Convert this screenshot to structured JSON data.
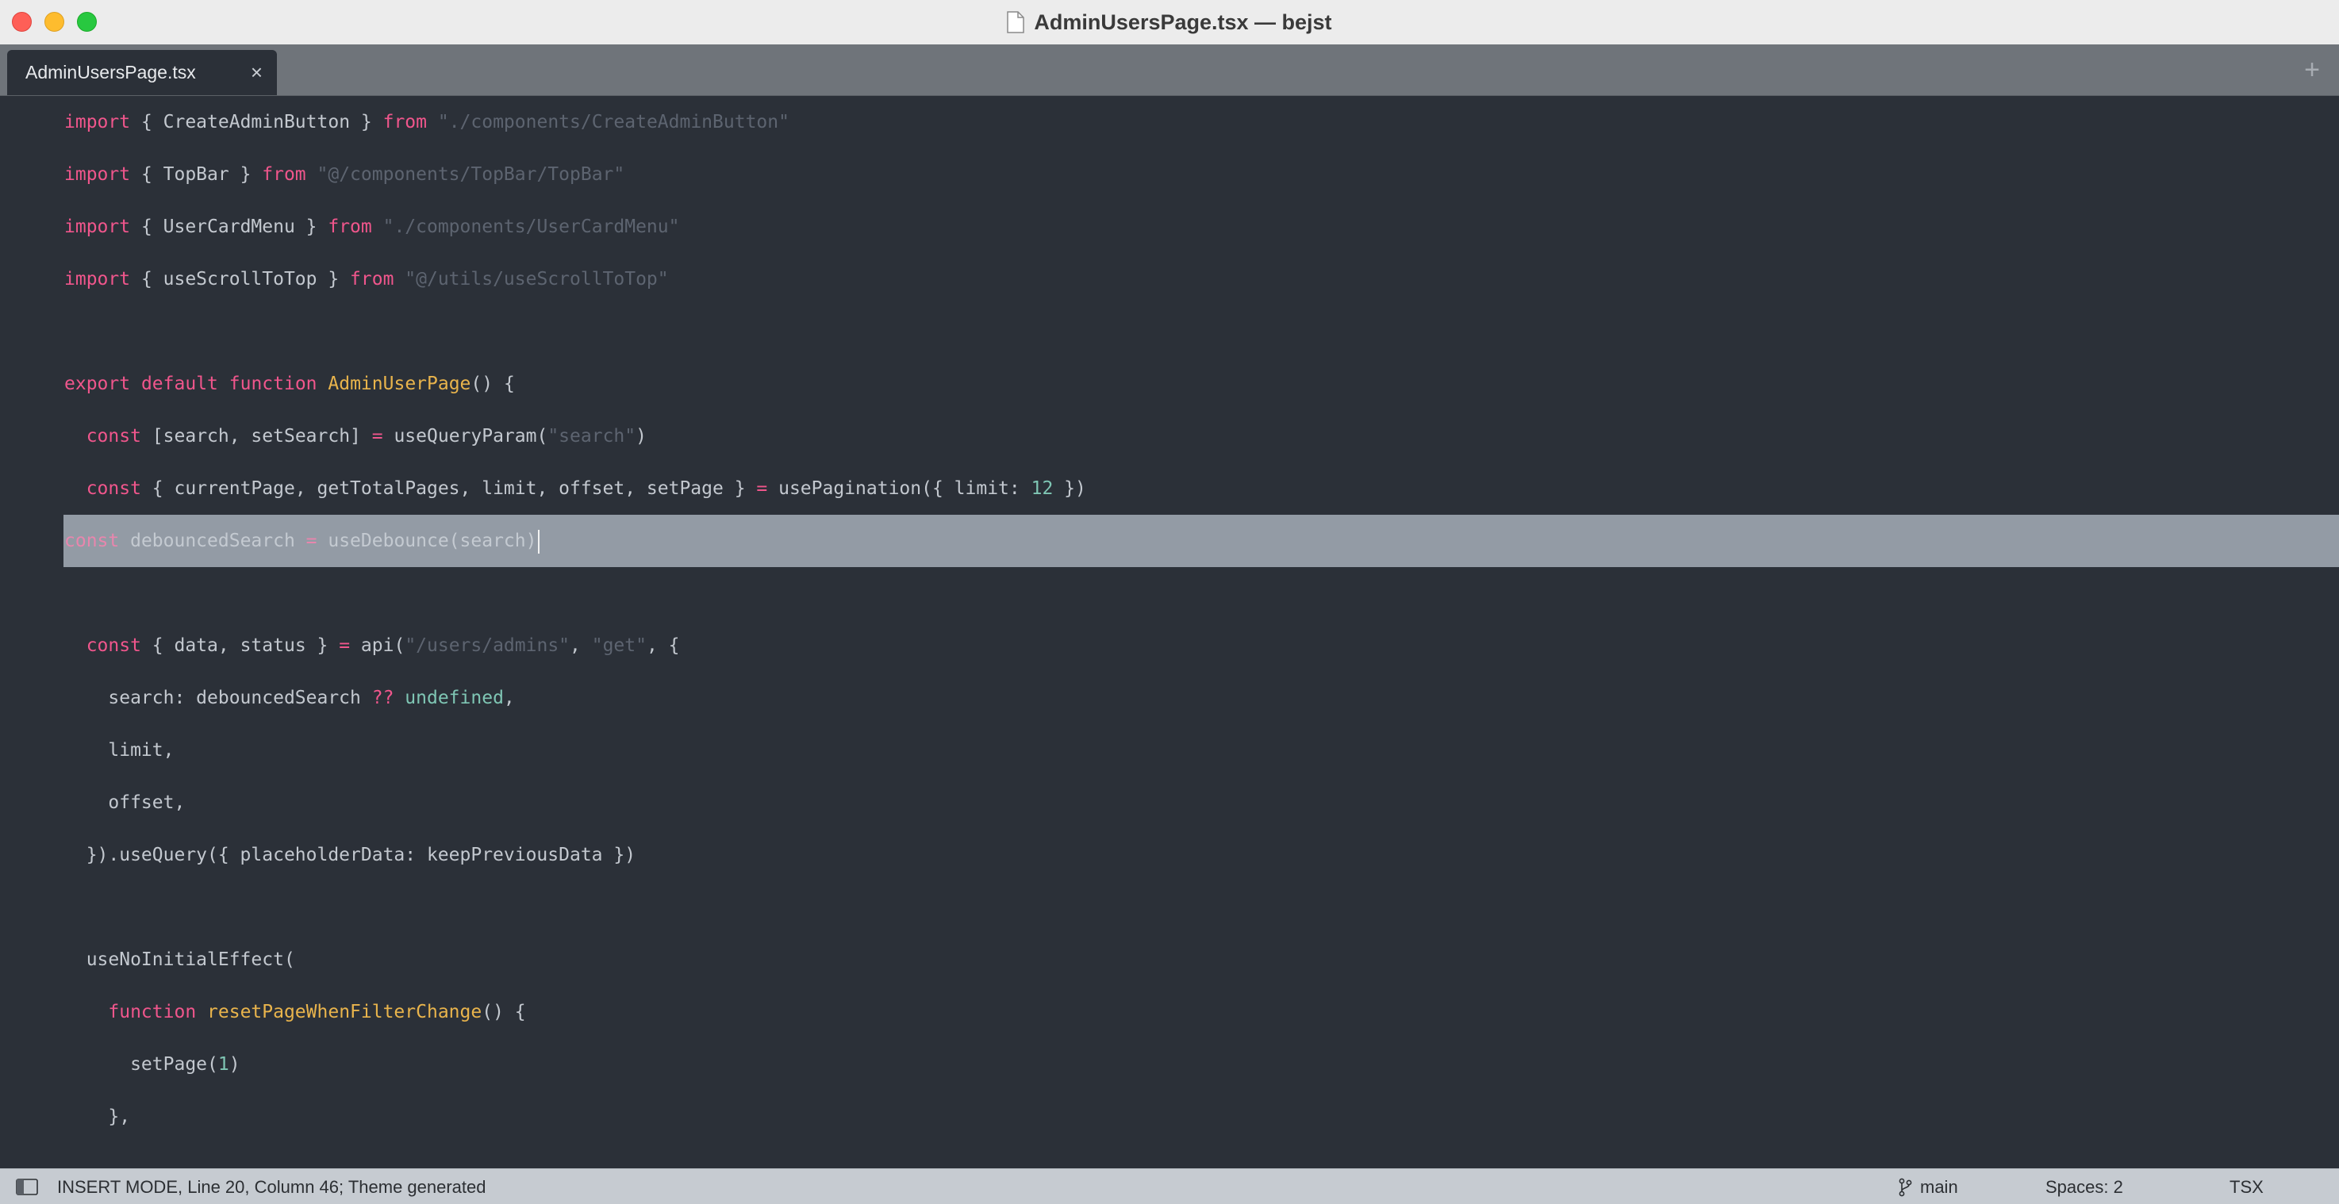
{
  "window": {
    "title": "AdminUsersPage.tsx — bejst"
  },
  "tabs": [
    {
      "label": "AdminUsersPage.tsx",
      "close_glyph": "×",
      "active": true
    }
  ],
  "new_tab_glyph": "+",
  "editor": {
    "current_line_index": 8,
    "lines": [
      [
        {
          "t": "import",
          "c": "kw"
        },
        {
          "t": " { CreateAdminButton } "
        },
        {
          "t": "from",
          "c": "kw"
        },
        {
          "t": " "
        },
        {
          "t": "\"./components/CreateAdminButton\"",
          "c": "str"
        }
      ],
      [
        {
          "t": "import",
          "c": "kw"
        },
        {
          "t": " { TopBar } "
        },
        {
          "t": "from",
          "c": "kw"
        },
        {
          "t": " "
        },
        {
          "t": "\"@/components/TopBar/TopBar\"",
          "c": "str"
        }
      ],
      [
        {
          "t": "import",
          "c": "kw"
        },
        {
          "t": " { UserCardMenu } "
        },
        {
          "t": "from",
          "c": "kw"
        },
        {
          "t": " "
        },
        {
          "t": "\"./components/UserCardMenu\"",
          "c": "str"
        }
      ],
      [
        {
          "t": "import",
          "c": "kw"
        },
        {
          "t": " { useScrollToTop } "
        },
        {
          "t": "from",
          "c": "kw"
        },
        {
          "t": " "
        },
        {
          "t": "\"@/utils/useScrollToTop\"",
          "c": "str"
        }
      ],
      [],
      [
        {
          "t": "export",
          "c": "kw"
        },
        {
          "t": " "
        },
        {
          "t": "default",
          "c": "kw"
        },
        {
          "t": " "
        },
        {
          "t": "function",
          "c": "kw"
        },
        {
          "t": " "
        },
        {
          "t": "AdminUserPage",
          "c": "fn"
        },
        {
          "t": "() {"
        }
      ],
      [
        {
          "t": "  "
        },
        {
          "t": "const",
          "c": "kw"
        },
        {
          "t": " [search, setSearch] "
        },
        {
          "t": "=",
          "c": "op"
        },
        {
          "t": " useQueryParam("
        },
        {
          "t": "\"search\"",
          "c": "str"
        },
        {
          "t": ")"
        }
      ],
      [
        {
          "t": "  "
        },
        {
          "t": "const",
          "c": "kw"
        },
        {
          "t": " { currentPage, getTotalPages, limit, offset, setPage } "
        },
        {
          "t": "=",
          "c": "op"
        },
        {
          "t": " usePagination({ limit: "
        },
        {
          "t": "12",
          "c": "num"
        },
        {
          "t": " })"
        }
      ],
      [
        {
          "t": "const",
          "c": "kw"
        },
        {
          "t": " debouncedSearch "
        },
        {
          "t": "=",
          "c": "op"
        },
        {
          "t": " useDebounce(search)"
        }
      ],
      [],
      [
        {
          "t": "  "
        },
        {
          "t": "const",
          "c": "kw"
        },
        {
          "t": " { data, status } "
        },
        {
          "t": "=",
          "c": "op"
        },
        {
          "t": " api("
        },
        {
          "t": "\"/users/admins\"",
          "c": "str"
        },
        {
          "t": ", "
        },
        {
          "t": "\"get\"",
          "c": "str"
        },
        {
          "t": ", {"
        }
      ],
      [
        {
          "t": "    search: debouncedSearch "
        },
        {
          "t": "??",
          "c": "op"
        },
        {
          "t": " "
        },
        {
          "t": "undefined",
          "c": "num"
        },
        {
          "t": ","
        }
      ],
      [
        {
          "t": "    limit,"
        }
      ],
      [
        {
          "t": "    offset,"
        }
      ],
      [
        {
          "t": "  }).useQuery({ placeholderData: keepPreviousData })"
        }
      ],
      [],
      [
        {
          "t": "  useNoInitialEffect("
        }
      ],
      [
        {
          "t": "    "
        },
        {
          "t": "function",
          "c": "kw"
        },
        {
          "t": " "
        },
        {
          "t": "resetPageWhenFilterChange",
          "c": "fn"
        },
        {
          "t": "() {"
        }
      ],
      [
        {
          "t": "      setPage("
        },
        {
          "t": "1",
          "c": "num"
        },
        {
          "t": ")"
        }
      ],
      [
        {
          "t": "    },"
        }
      ]
    ]
  },
  "statusbar": {
    "mode_text": "INSERT MODE, Line 20, Column 46; Theme generated",
    "branch": "main",
    "spaces": "Spaces: 2",
    "language": "TSX"
  },
  "icons": {
    "file": "document-icon",
    "sidebar_toggle": "sidebar-toggle-icon",
    "branch": "git-branch-icon"
  },
  "colors": {
    "editor_bg": "#2b3038",
    "keyword": "#f0568c",
    "function": "#e9b44c",
    "string": "#5d6470",
    "number": "#7fc6b4",
    "highlight": "#939ba5"
  }
}
